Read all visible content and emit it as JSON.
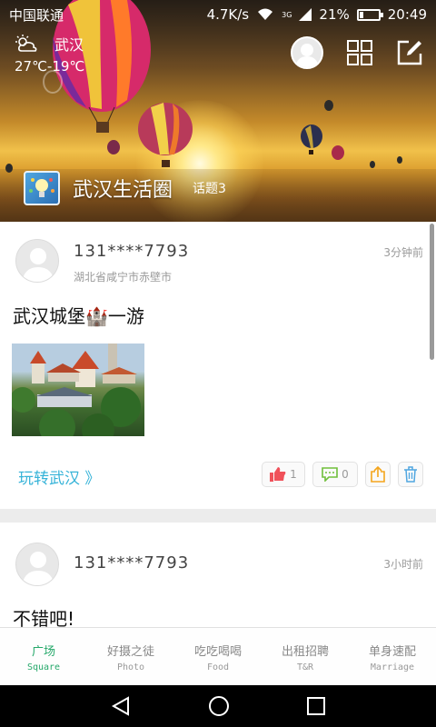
{
  "status": {
    "carrier": "中国联通",
    "speed": "4.7K/s",
    "net": "3G",
    "battery": "21%",
    "battery_level": 0.21,
    "time": "20:49"
  },
  "weather": {
    "city": "武汉",
    "temp": "27℃-19℃",
    "icon": "partly-cloudy-icon"
  },
  "header": {
    "community_name": "武汉生活圈",
    "topic_count": "话题3"
  },
  "posts": [
    {
      "username": "131****7793",
      "location": "湖北省咸宁市赤壁市",
      "time": "3分钟前",
      "title": "武汉城堡🏰一游",
      "tag": "玩转武汉 》",
      "likes": "1",
      "comments": "0"
    },
    {
      "username": "131****7793",
      "time": "3小时前",
      "title": "不错吧!"
    }
  ],
  "tabs": [
    {
      "cn": "广场",
      "en": "Square",
      "active": true
    },
    {
      "cn": "好摄之徒",
      "en": "Photo"
    },
    {
      "cn": "吃吃喝喝",
      "en": "Food"
    },
    {
      "cn": "出租招聘",
      "en": "T&R"
    },
    {
      "cn": "单身速配",
      "en": "Marriage"
    }
  ],
  "colors": {
    "accent": "#25a86a",
    "tag": "#36b3d8",
    "like": "#f0515a",
    "comment": "#6fbf3a",
    "share": "#f4a51c",
    "delete": "#4fa6e0"
  }
}
